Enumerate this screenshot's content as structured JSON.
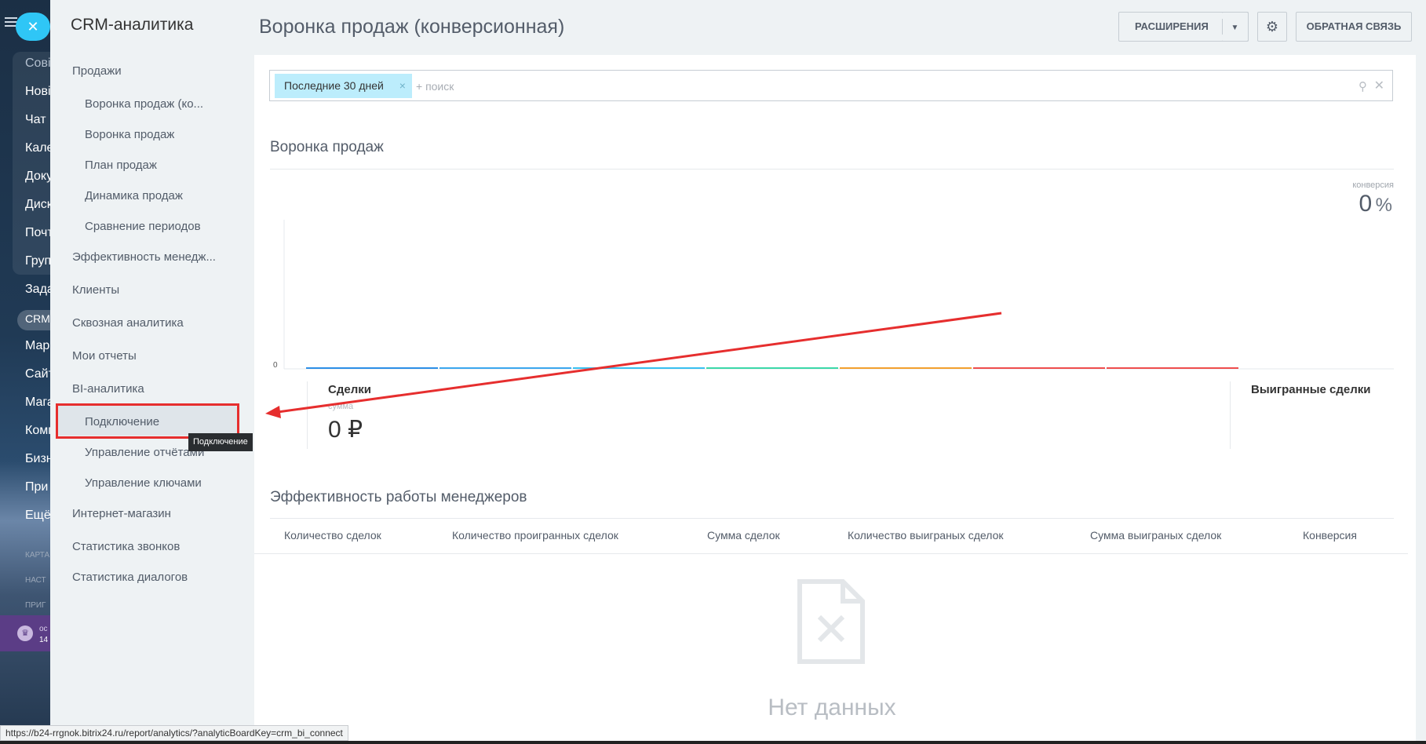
{
  "rail": {
    "items": [
      "Сові",
      "Нові",
      "Чат",
      "Кале",
      "Доку",
      "Диск",
      "Почт",
      "Груп",
      "Зада",
      "CRM",
      "Марк",
      "Сайт",
      "Мага",
      "Комп",
      "Бизн",
      "При",
      "Ещё"
    ],
    "small": [
      "КАРТА",
      "НАСТ",
      "ПРИГ"
    ],
    "footer_line1": "ос",
    "footer_line2": "14"
  },
  "menu": {
    "title": "CRM-аналитика",
    "items": [
      {
        "label": "Продажи",
        "sub": false
      },
      {
        "label": "Воронка продаж (ко...",
        "sub": true
      },
      {
        "label": "Воронка продаж",
        "sub": true
      },
      {
        "label": "План продаж",
        "sub": true
      },
      {
        "label": "Динамика продаж",
        "sub": true
      },
      {
        "label": "Сравнение периодов",
        "sub": true
      },
      {
        "label": "Эффективность менедж...",
        "sub": false
      },
      {
        "label": "Клиенты",
        "sub": false
      },
      {
        "label": "Сквозная аналитика",
        "sub": false
      },
      {
        "label": "Мои отчеты",
        "sub": false
      },
      {
        "label": "BI-аналитика",
        "sub": false
      },
      {
        "label": "Подключение",
        "sub": true
      },
      {
        "label": "Управление отчётами",
        "sub": true
      },
      {
        "label": "Управление ключами",
        "sub": true
      },
      {
        "label": "Интернет-магазин",
        "sub": false
      },
      {
        "label": "Статистика звонков",
        "sub": false
      },
      {
        "label": "Статистика диалогов",
        "sub": false
      }
    ],
    "tooltip": "Подключение"
  },
  "header": {
    "title": "Воронка продаж (конверсионная)",
    "extensions_button": "РАСШИРЕНИЯ",
    "feedback_button": "ОБРАТНАЯ СВЯЗЬ",
    "gear_icon": "gear-icon",
    "dropdown_icon": "chevron-down-icon"
  },
  "filter": {
    "tag": "Последние 30 дней",
    "tag_remove": "×",
    "search_placeholder": "+ поиск"
  },
  "funnel": {
    "title": "Воронка продаж",
    "conversion_label": "конверсия",
    "conversion_value": "0",
    "conversion_unit": "%",
    "deals_label": "Сделки",
    "deals_sum_label": "сумма",
    "deals_sum_value": "0 ₽",
    "won_label": "Выигранные сделки"
  },
  "chart_data": {
    "type": "bar",
    "y_ticks": [
      "0"
    ],
    "stage_colors": [
      "#2d8fe6",
      "#3ca7ee",
      "#39c0f0",
      "#3cd8a8",
      "#f3a02e",
      "#ef4d4d",
      "#ef4d4d"
    ],
    "values": [
      0,
      0,
      0,
      0,
      0,
      0,
      0
    ]
  },
  "managers": {
    "title": "Эффективность работы менеджеров",
    "columns": [
      "Количество сделок",
      "Количество проигранных сделок",
      "Сумма сделок",
      "Количество выиграных сделок",
      "Сумма выиграных сделок",
      "Конверсия"
    ],
    "empty_text": "Нет данных"
  },
  "status_url": "https://b24-rrgnok.bitrix24.ru/report/analytics/?analyticBoardKey=crm_bi_connect",
  "colors": {
    "accent": "#2fc6f6",
    "filter_tag": "#bcedfc",
    "annotation": "#e62e2e"
  }
}
